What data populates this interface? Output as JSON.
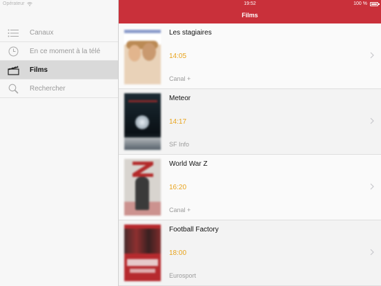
{
  "status": {
    "carrier": "Opérateur",
    "time": "19:52",
    "battery": "100 %"
  },
  "header": {
    "title": "Films"
  },
  "sidebar": {
    "items": [
      {
        "label": "Canaux",
        "icon": "list-icon",
        "active": false
      },
      {
        "label": "En ce moment à la télé",
        "icon": "clock-icon",
        "active": false
      },
      {
        "label": "Films",
        "icon": "clapperboard-icon",
        "active": true
      },
      {
        "label": "Rechercher",
        "icon": "search-icon",
        "active": false
      }
    ]
  },
  "films": [
    {
      "title": "Les stagiaires",
      "time": "14:05",
      "channel": "Canal +"
    },
    {
      "title": "Meteor",
      "time": "14:17",
      "channel": "SF Info"
    },
    {
      "title": "World War Z",
      "time": "16:20",
      "channel": "Canal +"
    },
    {
      "title": "Football Factory",
      "time": "18:00",
      "channel": "Eurosport"
    }
  ],
  "colors": {
    "accent": "#c9303a",
    "time": "#e8a31c",
    "channel": "#9b9b9b"
  }
}
